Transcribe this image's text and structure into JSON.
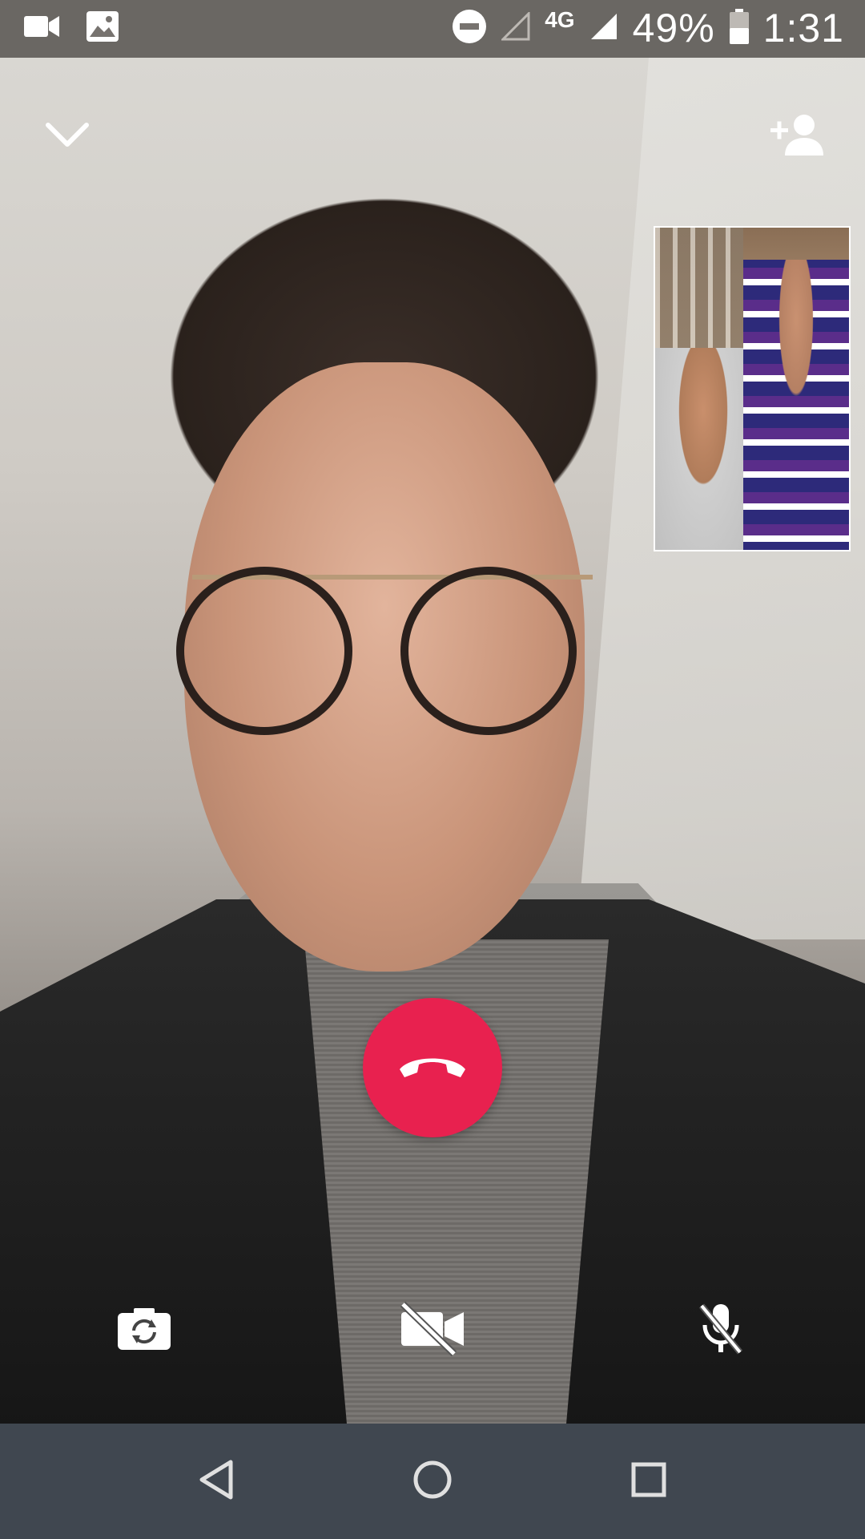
{
  "status_bar": {
    "left_icons": [
      "video-camera-icon",
      "image-icon"
    ],
    "network_label": "4G",
    "battery": "49%",
    "time": "1:31"
  },
  "call": {
    "top_left_icon": "chevron-down-icon",
    "top_right_icon": "add-person-icon",
    "end_call_icon": "phone-hangup-icon",
    "end_call_color": "#e8214f",
    "controls": [
      {
        "name": "switch-camera",
        "icon": "camera-switch-icon"
      },
      {
        "name": "video-off",
        "icon": "video-off-icon"
      },
      {
        "name": "mute",
        "icon": "mic-off-icon"
      }
    ]
  },
  "nav_bar": {
    "buttons": [
      "back-icon",
      "home-icon",
      "recents-icon"
    ],
    "color": "#404750"
  }
}
